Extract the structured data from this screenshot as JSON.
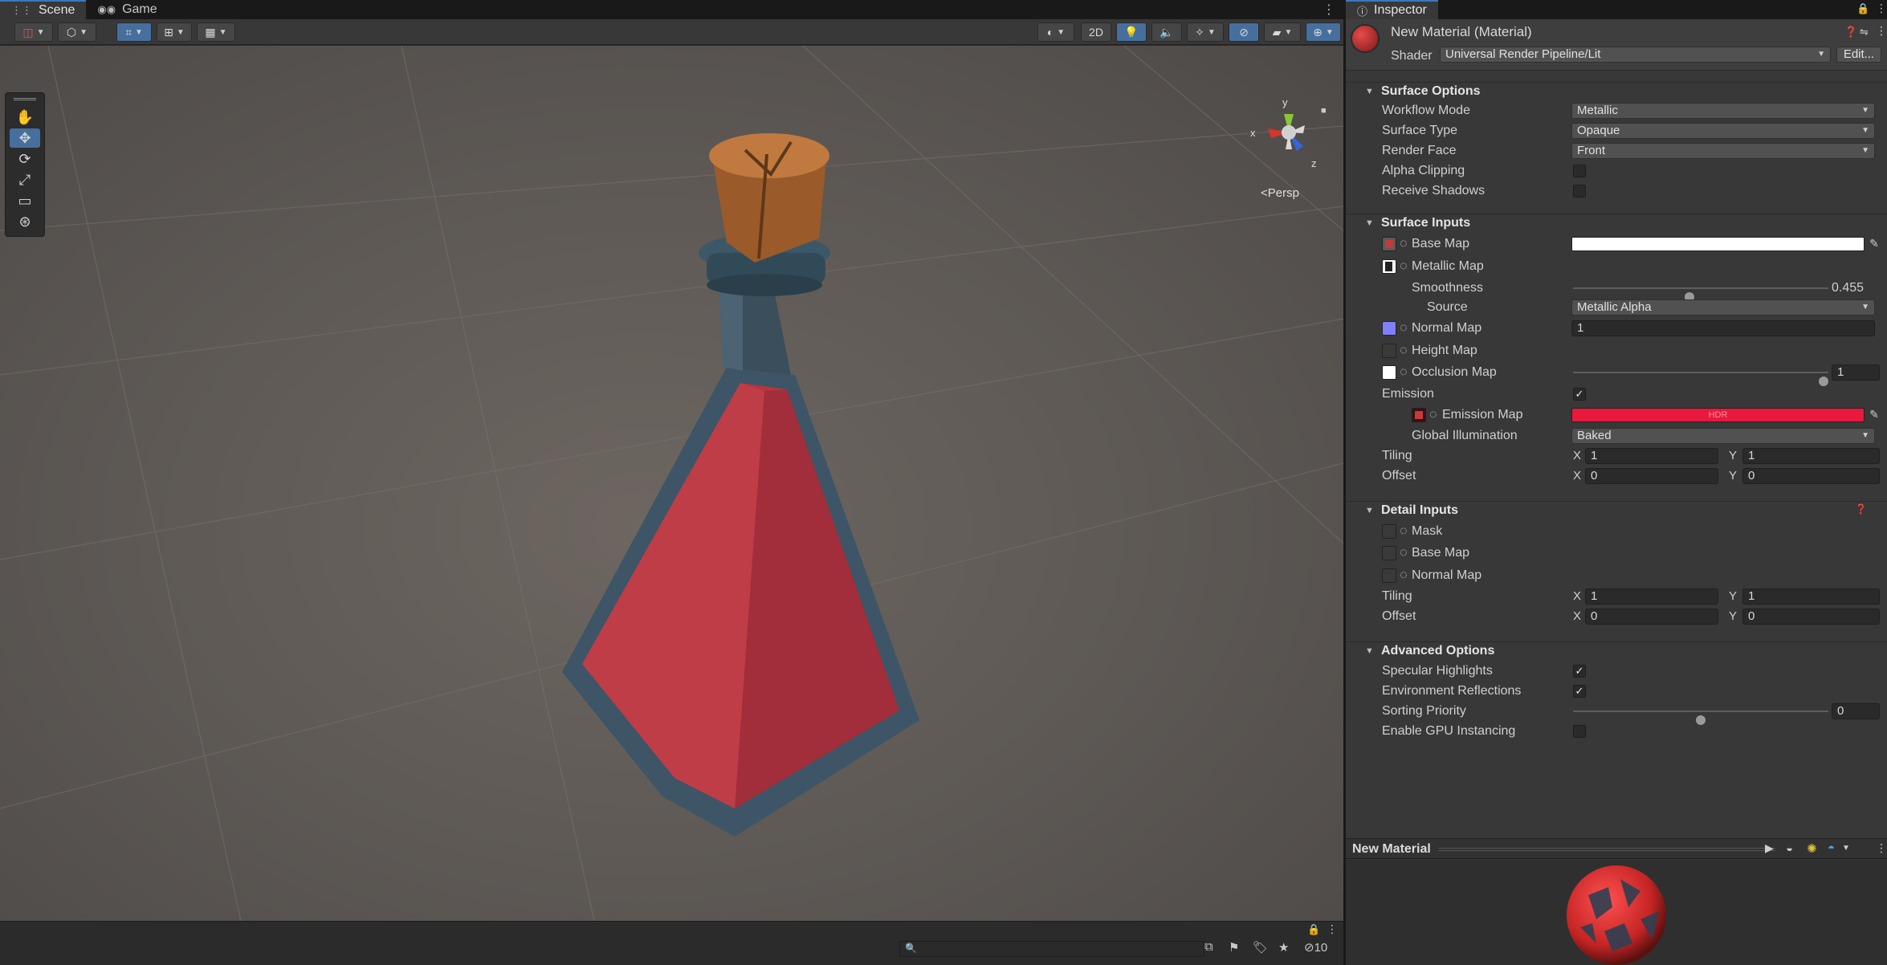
{
  "scene_tabs": [
    {
      "label": "Scene",
      "icon": "grid-icon"
    },
    {
      "label": "Game",
      "icon": "gamepad-icon"
    }
  ],
  "toolbar": {
    "view_2d_label": "2D"
  },
  "scene_view": {
    "camera_mode": "Persp",
    "gizmo_axes": {
      "x": "x",
      "y": "y",
      "z": "z"
    }
  },
  "status_bar": {
    "hidden_count": "10"
  },
  "inspector": {
    "tab_label": "Inspector",
    "title": "New Material (Material)",
    "shader_label": "Shader",
    "shader_value": "Universal Render Pipeline/Lit",
    "edit_button": "Edit...",
    "surface_options": {
      "title": "Surface Options",
      "workflow_mode_label": "Workflow Mode",
      "workflow_mode_value": "Metallic",
      "surface_type_label": "Surface Type",
      "surface_type_value": "Opaque",
      "render_face_label": "Render Face",
      "render_face_value": "Front",
      "alpha_clipping_label": "Alpha Clipping",
      "alpha_clipping_checked": false,
      "receive_shadows_label": "Receive Shadows",
      "receive_shadows_checked": false
    },
    "surface_inputs": {
      "title": "Surface Inputs",
      "base_map_label": "Base Map",
      "base_map_color": "#ffffff",
      "metallic_map_label": "Metallic Map",
      "smoothness_label": "Smoothness",
      "smoothness_value": "0.455",
      "smoothness_fraction": 0.455,
      "source_label": "Source",
      "source_value": "Metallic Alpha",
      "normal_map_label": "Normal Map",
      "normal_map_value": "1",
      "height_map_label": "Height Map",
      "occlusion_map_label": "Occlusion Map",
      "occlusion_value": "1",
      "occlusion_fraction": 1.0,
      "emission_label": "Emission",
      "emission_checked": true,
      "emission_map_label": "Emission Map",
      "emission_color": "#e8193c",
      "emission_hdr_text": "HDR",
      "global_illumination_label": "Global Illumination",
      "global_illumination_value": "Baked",
      "tiling_label": "Tiling",
      "tiling_x": "1",
      "tiling_y": "1",
      "offset_label": "Offset",
      "offset_x": "0",
      "offset_y": "0",
      "x_label": "X",
      "y_label": "Y"
    },
    "detail_inputs": {
      "title": "Detail Inputs",
      "mask_label": "Mask",
      "base_map_label": "Base Map",
      "normal_map_label": "Normal Map",
      "tiling_label": "Tiling",
      "tiling_x": "1",
      "tiling_y": "1",
      "offset_label": "Offset",
      "offset_x": "0",
      "offset_y": "0",
      "x_label": "X",
      "y_label": "Y"
    },
    "advanced_options": {
      "title": "Advanced Options",
      "specular_highlights_label": "Specular Highlights",
      "specular_highlights_checked": true,
      "environment_reflections_label": "Environment Reflections",
      "environment_reflections_checked": true,
      "sorting_priority_label": "Sorting Priority",
      "sorting_priority_value": "0",
      "sorting_priority_fraction": 0.5,
      "gpu_instancing_label": "Enable GPU Instancing",
      "gpu_instancing_checked": false
    },
    "preview": {
      "title": "New Material"
    }
  },
  "colors": {
    "accent_blue": "#466f9e",
    "potion_red": "#b8343f",
    "glass_blue": "#3d5566",
    "cork_brown": "#9a5a2a"
  }
}
